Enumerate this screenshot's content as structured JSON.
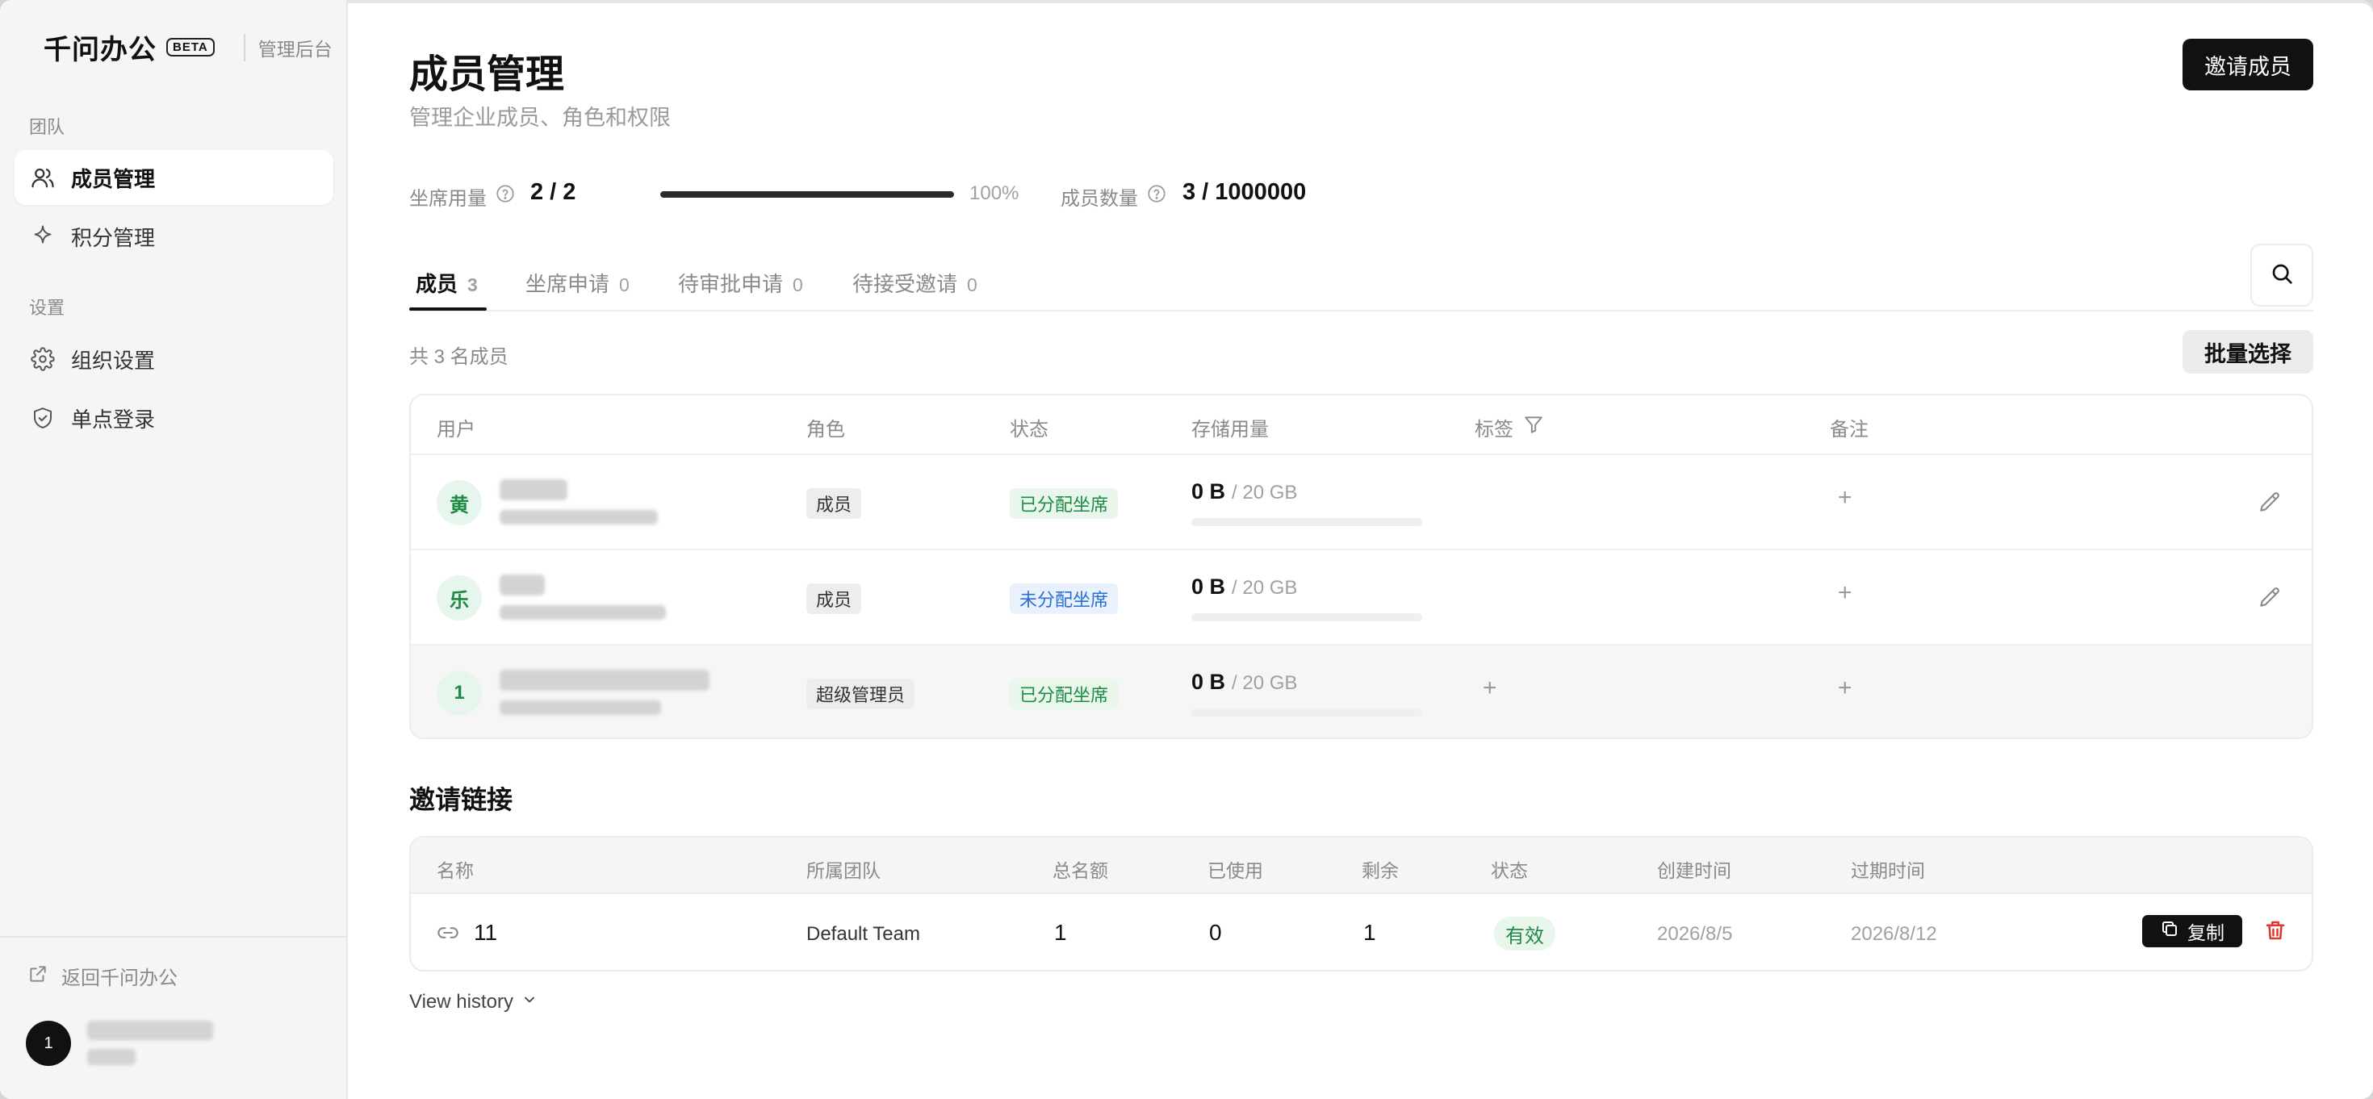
{
  "brand": {
    "name": "千问办公",
    "badge": "BETA",
    "subtitle": "管理后台"
  },
  "sidebar": {
    "sections": [
      {
        "label": "团队"
      },
      {
        "label": "设置"
      }
    ],
    "items": [
      {
        "label": "成员管理",
        "icon": "users-icon",
        "active": true
      },
      {
        "label": "积分管理",
        "icon": "sparkle-icon",
        "active": false
      },
      {
        "label": "组织设置",
        "icon": "gear-icon",
        "active": false
      },
      {
        "label": "单点登录",
        "icon": "shield-icon",
        "active": false
      }
    ],
    "back_link": "返回千问办公",
    "user_avatar": "1"
  },
  "header": {
    "title": "成员管理",
    "subtitle": "管理企业成员、角色和权限",
    "invite_button": "邀请成员"
  },
  "stats": {
    "seat_usage_label": "坐席用量",
    "seat_usage_value": "2 / 2",
    "seat_usage_percent_text": "100%",
    "seat_usage_fraction": 1.0,
    "member_count_label": "成员数量",
    "member_count_value": "3 / 1000000"
  },
  "tabs": [
    {
      "label": "成员",
      "count": "3",
      "active": true
    },
    {
      "label": "坐席申请",
      "count": "0",
      "active": false
    },
    {
      "label": "待审批申请",
      "count": "0",
      "active": false
    },
    {
      "label": "待接受邀请",
      "count": "0",
      "active": false
    }
  ],
  "members": {
    "total_text": "共 3 名成员",
    "batch_button": "批量选择",
    "columns": {
      "user": "用户",
      "role": "角色",
      "status": "状态",
      "storage": "存储用量",
      "tags": "标签",
      "notes": "备注"
    },
    "rows": [
      {
        "avatar": "黄",
        "role": "成员",
        "status": "已分配坐席",
        "status_color": "#1f8a46",
        "storage_used": "0 B",
        "storage_quota": "/ 20 GB",
        "storage_fraction": 0,
        "notes_add": "+"
      },
      {
        "avatar": "乐",
        "role": "成员",
        "status": "未分配坐席",
        "status_color": "#2a6fd6",
        "storage_used": "0 B",
        "storage_quota": "/ 20 GB",
        "storage_fraction": 0,
        "notes_add": "+"
      },
      {
        "avatar": "1",
        "role": "超级管理员",
        "status": "已分配坐席",
        "status_color": "#1f8a46",
        "storage_used": "0 B",
        "storage_quota": "/ 20 GB",
        "storage_fraction": 0,
        "tags_add": "+",
        "notes_add": "+"
      }
    ]
  },
  "invite_links": {
    "title": "邀请链接",
    "columns": {
      "name": "名称",
      "team": "所属团队",
      "total": "总名额",
      "used": "已使用",
      "remaining": "剩余",
      "status": "状态",
      "created": "创建时间",
      "expires": "过期时间"
    },
    "rows": [
      {
        "name": "11",
        "team": "Default Team",
        "total": "1",
        "used": "0",
        "remaining": "1",
        "status": "有效",
        "created": "2026/8/5",
        "expires": "2026/8/12",
        "copy_label": "复制"
      }
    ],
    "view_history": "View history"
  },
  "colors": {
    "accent": "#111111",
    "success": "#1f8a46",
    "info": "#2a6fd6",
    "danger": "#e0362c"
  }
}
